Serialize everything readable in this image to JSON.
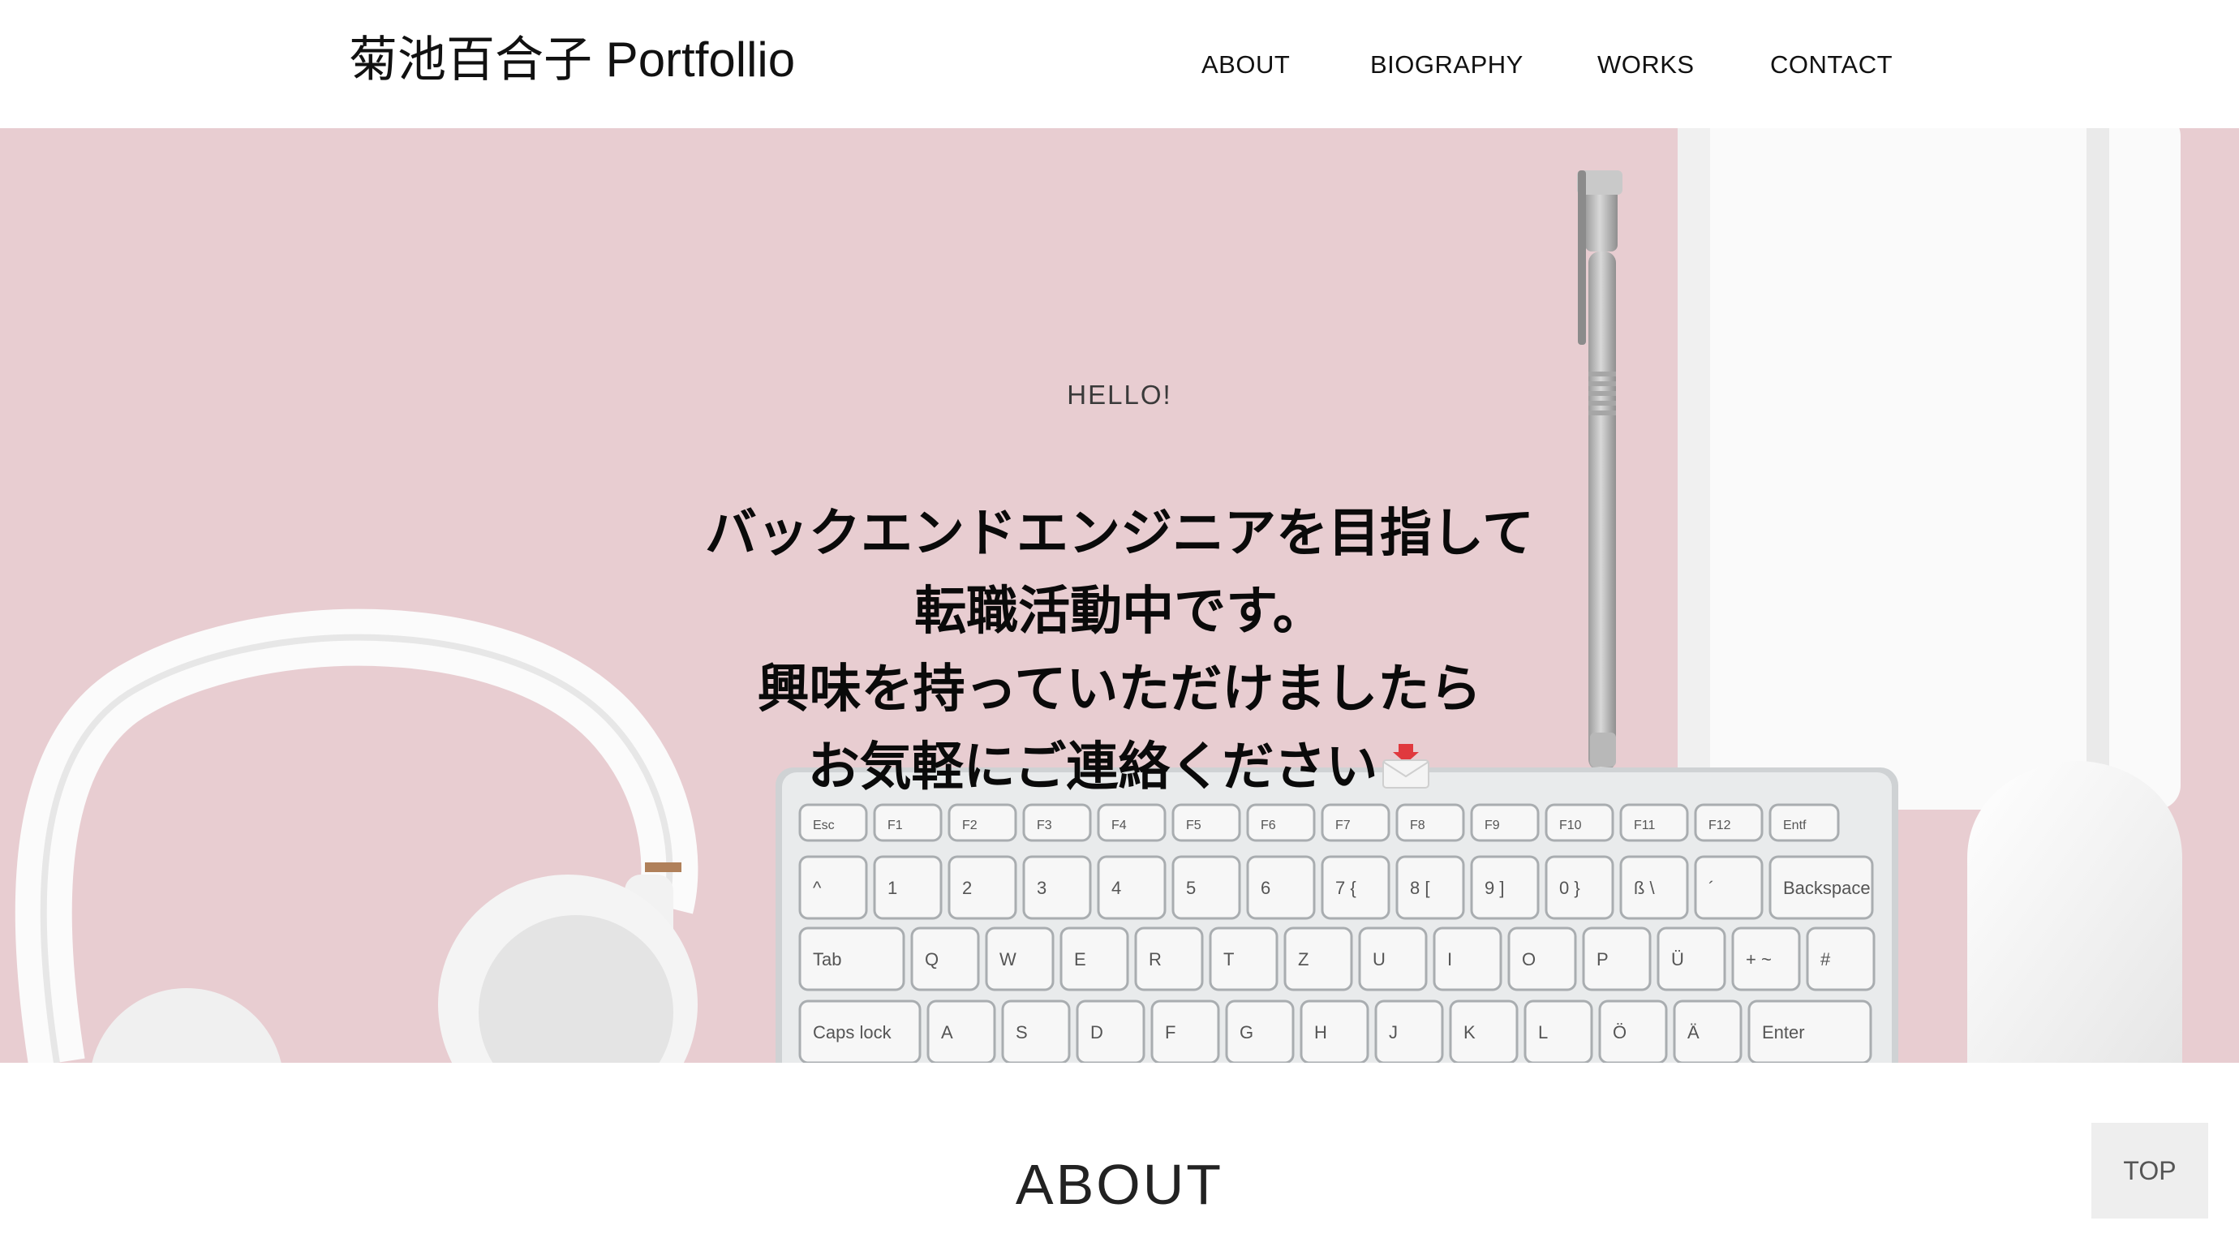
{
  "header": {
    "site_title": "菊池百合子 Portfollio",
    "nav": [
      {
        "label": "ABOUT"
      },
      {
        "label": "BIOGRAPHY"
      },
      {
        "label": "WORKS"
      },
      {
        "label": "CONTACT"
      }
    ]
  },
  "hero": {
    "eyebrow": "HELLO!",
    "headline_lines": [
      "バックエンドエンジニアを目指して",
      "転職活動中です。",
      "興味を持っていただけましたら",
      "お気軽にご連絡ください"
    ],
    "headline_icon": "envelope-icon",
    "background_color": "#e8cdd1"
  },
  "about": {
    "heading": "ABOUT"
  },
  "top_button": {
    "label": "TOP"
  },
  "keyboard": {
    "row_fn": [
      "Esc",
      "F1",
      "F2",
      "F3",
      "F4",
      "F5",
      "F6",
      "F7",
      "F8",
      "F9",
      "F10",
      "F11",
      "F12",
      "Entf"
    ],
    "row_num": [
      "^",
      "1",
      "2",
      "3",
      "4",
      "5",
      "6",
      "7 {",
      "8 [",
      "9 ]",
      "0 }",
      "ß \\",
      "´",
      "Backspace"
    ],
    "row_q": [
      "Tab",
      "Q",
      "W",
      "E",
      "R",
      "T",
      "Z",
      "U",
      "I",
      "O",
      "P",
      "Ü",
      "+ ~",
      "#"
    ],
    "row_a": [
      "Caps lock",
      "A",
      "S",
      "D",
      "F",
      "G",
      "H",
      "J",
      "K",
      "L",
      "Ö",
      "Ä",
      "Enter"
    ]
  }
}
